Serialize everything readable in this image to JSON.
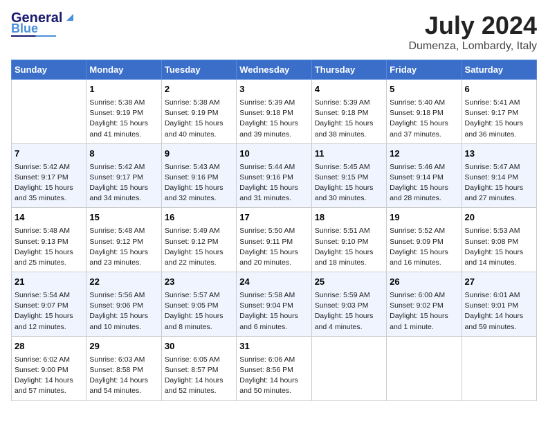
{
  "header": {
    "logo_line1": "General",
    "logo_line2": "Blue",
    "month": "July 2024",
    "location": "Dumenza, Lombardy, Italy"
  },
  "columns": [
    "Sunday",
    "Monday",
    "Tuesday",
    "Wednesday",
    "Thursday",
    "Friday",
    "Saturday"
  ],
  "weeks": [
    [
      {
        "date": "",
        "info": ""
      },
      {
        "date": "1",
        "info": "Sunrise: 5:38 AM\nSunset: 9:19 PM\nDaylight: 15 hours\nand 41 minutes."
      },
      {
        "date": "2",
        "info": "Sunrise: 5:38 AM\nSunset: 9:19 PM\nDaylight: 15 hours\nand 40 minutes."
      },
      {
        "date": "3",
        "info": "Sunrise: 5:39 AM\nSunset: 9:18 PM\nDaylight: 15 hours\nand 39 minutes."
      },
      {
        "date": "4",
        "info": "Sunrise: 5:39 AM\nSunset: 9:18 PM\nDaylight: 15 hours\nand 38 minutes."
      },
      {
        "date": "5",
        "info": "Sunrise: 5:40 AM\nSunset: 9:18 PM\nDaylight: 15 hours\nand 37 minutes."
      },
      {
        "date": "6",
        "info": "Sunrise: 5:41 AM\nSunset: 9:17 PM\nDaylight: 15 hours\nand 36 minutes."
      }
    ],
    [
      {
        "date": "7",
        "info": "Sunrise: 5:42 AM\nSunset: 9:17 PM\nDaylight: 15 hours\nand 35 minutes."
      },
      {
        "date": "8",
        "info": "Sunrise: 5:42 AM\nSunset: 9:17 PM\nDaylight: 15 hours\nand 34 minutes."
      },
      {
        "date": "9",
        "info": "Sunrise: 5:43 AM\nSunset: 9:16 PM\nDaylight: 15 hours\nand 32 minutes."
      },
      {
        "date": "10",
        "info": "Sunrise: 5:44 AM\nSunset: 9:16 PM\nDaylight: 15 hours\nand 31 minutes."
      },
      {
        "date": "11",
        "info": "Sunrise: 5:45 AM\nSunset: 9:15 PM\nDaylight: 15 hours\nand 30 minutes."
      },
      {
        "date": "12",
        "info": "Sunrise: 5:46 AM\nSunset: 9:14 PM\nDaylight: 15 hours\nand 28 minutes."
      },
      {
        "date": "13",
        "info": "Sunrise: 5:47 AM\nSunset: 9:14 PM\nDaylight: 15 hours\nand 27 minutes."
      }
    ],
    [
      {
        "date": "14",
        "info": "Sunrise: 5:48 AM\nSunset: 9:13 PM\nDaylight: 15 hours\nand 25 minutes."
      },
      {
        "date": "15",
        "info": "Sunrise: 5:48 AM\nSunset: 9:12 PM\nDaylight: 15 hours\nand 23 minutes."
      },
      {
        "date": "16",
        "info": "Sunrise: 5:49 AM\nSunset: 9:12 PM\nDaylight: 15 hours\nand 22 minutes."
      },
      {
        "date": "17",
        "info": "Sunrise: 5:50 AM\nSunset: 9:11 PM\nDaylight: 15 hours\nand 20 minutes."
      },
      {
        "date": "18",
        "info": "Sunrise: 5:51 AM\nSunset: 9:10 PM\nDaylight: 15 hours\nand 18 minutes."
      },
      {
        "date": "19",
        "info": "Sunrise: 5:52 AM\nSunset: 9:09 PM\nDaylight: 15 hours\nand 16 minutes."
      },
      {
        "date": "20",
        "info": "Sunrise: 5:53 AM\nSunset: 9:08 PM\nDaylight: 15 hours\nand 14 minutes."
      }
    ],
    [
      {
        "date": "21",
        "info": "Sunrise: 5:54 AM\nSunset: 9:07 PM\nDaylight: 15 hours\nand 12 minutes."
      },
      {
        "date": "22",
        "info": "Sunrise: 5:56 AM\nSunset: 9:06 PM\nDaylight: 15 hours\nand 10 minutes."
      },
      {
        "date": "23",
        "info": "Sunrise: 5:57 AM\nSunset: 9:05 PM\nDaylight: 15 hours\nand 8 minutes."
      },
      {
        "date": "24",
        "info": "Sunrise: 5:58 AM\nSunset: 9:04 PM\nDaylight: 15 hours\nand 6 minutes."
      },
      {
        "date": "25",
        "info": "Sunrise: 5:59 AM\nSunset: 9:03 PM\nDaylight: 15 hours\nand 4 minutes."
      },
      {
        "date": "26",
        "info": "Sunrise: 6:00 AM\nSunset: 9:02 PM\nDaylight: 15 hours\nand 1 minute."
      },
      {
        "date": "27",
        "info": "Sunrise: 6:01 AM\nSunset: 9:01 PM\nDaylight: 14 hours\nand 59 minutes."
      }
    ],
    [
      {
        "date": "28",
        "info": "Sunrise: 6:02 AM\nSunset: 9:00 PM\nDaylight: 14 hours\nand 57 minutes."
      },
      {
        "date": "29",
        "info": "Sunrise: 6:03 AM\nSunset: 8:58 PM\nDaylight: 14 hours\nand 54 minutes."
      },
      {
        "date": "30",
        "info": "Sunrise: 6:05 AM\nSunset: 8:57 PM\nDaylight: 14 hours\nand 52 minutes."
      },
      {
        "date": "31",
        "info": "Sunrise: 6:06 AM\nSunset: 8:56 PM\nDaylight: 14 hours\nand 50 minutes."
      },
      {
        "date": "",
        "info": ""
      },
      {
        "date": "",
        "info": ""
      },
      {
        "date": "",
        "info": ""
      }
    ]
  ]
}
